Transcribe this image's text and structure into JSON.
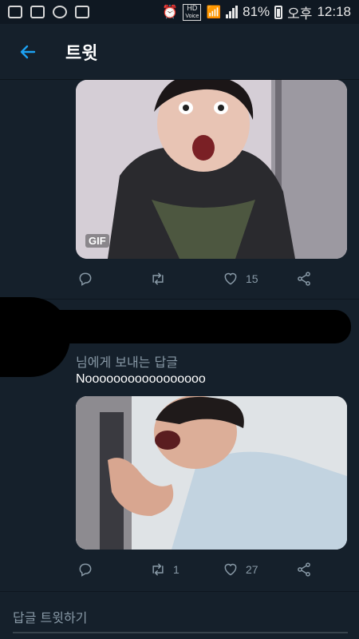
{
  "status_bar": {
    "battery": "81%",
    "period": "오후",
    "time": "12:18",
    "hd_label": "HD",
    "voice_label": "Voice"
  },
  "header": {
    "title": "트윗"
  },
  "tweet1": {
    "gif_badge": "GIF",
    "like_count": "15"
  },
  "tweet2": {
    "reply_to": "님에게 보내는 답글",
    "text": "Nooooooooooooooooo",
    "retweet_count": "1",
    "like_count": "27"
  },
  "reply_box": {
    "placeholder": "답글 트윗하기"
  },
  "colors": {
    "background": "#15202b",
    "accent": "#1da1f2",
    "muted": "#8899a6"
  }
}
